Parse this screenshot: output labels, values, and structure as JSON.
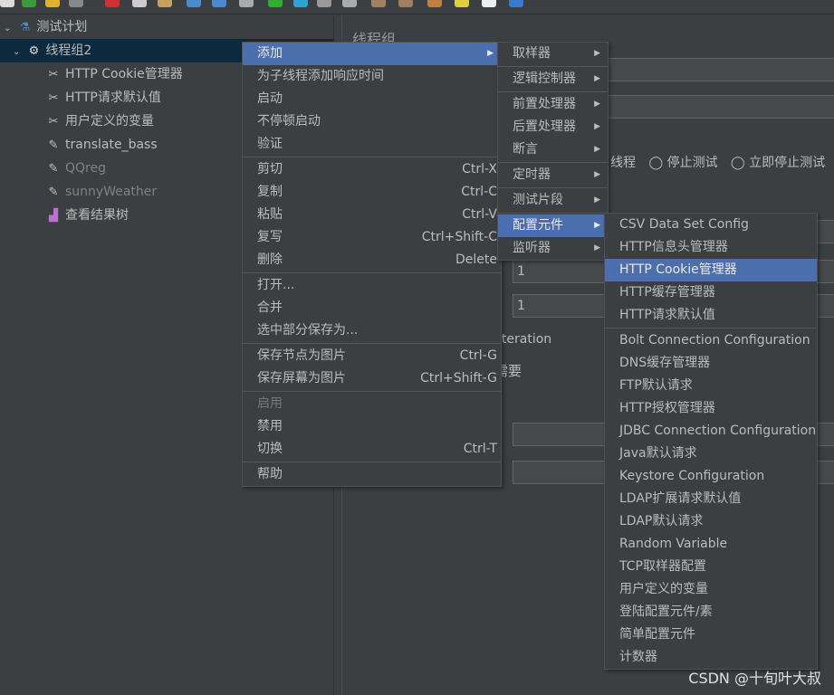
{
  "colors": {
    "background": "#3c3f41",
    "selection": "#0d293e",
    "menu_highlight": "#4b6eaf"
  },
  "tree": {
    "root": {
      "label": "测试计划",
      "icon": "flask-icon"
    },
    "thread_group": {
      "label": "线程组2",
      "icon": "gear-icon"
    },
    "children": [
      {
        "label": "HTTP Cookie管理器",
        "icon": "wrench-icon",
        "disabled": false
      },
      {
        "label": "HTTP请求默认值",
        "icon": "wrench-icon",
        "disabled": false
      },
      {
        "label": "用户定义的变量",
        "icon": "wrench-icon",
        "disabled": false
      },
      {
        "label": "translate_bass",
        "icon": "pipette-icon",
        "disabled": false
      },
      {
        "label": "QQreg",
        "icon": "pipette-icon",
        "disabled": true
      },
      {
        "label": "sunnyWeather",
        "icon": "pipette-icon",
        "disabled": true
      },
      {
        "label": "查看结果树",
        "icon": "chart-icon",
        "disabled": false
      }
    ]
  },
  "right": {
    "title": "线程组",
    "radio_partial": "线程",
    "radio_stop_test": "停止测试",
    "radio_stop_now": "立即停止测试",
    "field1": "1",
    "field2": "1",
    "iteration": "iteration",
    "need": "需要"
  },
  "context_menu": [
    {
      "label": "添加",
      "arrow": true,
      "hl": true
    },
    {
      "label": "为子线程添加响应时间"
    },
    {
      "label": "启动"
    },
    {
      "label": "不停顿启动"
    },
    {
      "label": "验证",
      "sep": true
    },
    {
      "label": "剪切",
      "sc": "Ctrl-X"
    },
    {
      "label": "复制",
      "sc": "Ctrl-C"
    },
    {
      "label": "粘贴",
      "sc": "Ctrl-V"
    },
    {
      "label": "复写",
      "sc": "Ctrl+Shift-C"
    },
    {
      "label": "删除",
      "sc": "Delete",
      "sep": true
    },
    {
      "label": "打开..."
    },
    {
      "label": "合并"
    },
    {
      "label": "选中部分保存为...",
      "sep": true
    },
    {
      "label": "保存节点为图片",
      "sc": "Ctrl-G"
    },
    {
      "label": "保存屏幕为图片",
      "sc": "Ctrl+Shift-G",
      "sep": true
    },
    {
      "label": "启用",
      "dis": true
    },
    {
      "label": "禁用"
    },
    {
      "label": "切换",
      "sc": "Ctrl-T",
      "sep": true
    },
    {
      "label": "帮助"
    }
  ],
  "add_menu": [
    {
      "label": "取样器",
      "arrow": true,
      "sep": true
    },
    {
      "label": "逻辑控制器",
      "arrow": true,
      "sep": true
    },
    {
      "label": "前置处理器",
      "arrow": true
    },
    {
      "label": "后置处理器",
      "arrow": true
    },
    {
      "label": "断言",
      "arrow": true,
      "sep": true
    },
    {
      "label": "定时器",
      "arrow": true,
      "sep": true
    },
    {
      "label": "测试片段",
      "arrow": true,
      "sep": true
    },
    {
      "label": "配置元件",
      "arrow": true,
      "hl": true
    },
    {
      "label": "监听器",
      "arrow": true
    }
  ],
  "config_menu": [
    {
      "label": "CSV Data Set Config"
    },
    {
      "label": "HTTP信息头管理器"
    },
    {
      "label": "HTTP Cookie管理器",
      "hl": true
    },
    {
      "label": "HTTP缓存管理器"
    },
    {
      "label": "HTTP请求默认值",
      "sep": true
    },
    {
      "label": "Bolt Connection Configuration"
    },
    {
      "label": "DNS缓存管理器"
    },
    {
      "label": "FTP默认请求"
    },
    {
      "label": "HTTP授权管理器"
    },
    {
      "label": "JDBC Connection Configuration"
    },
    {
      "label": "Java默认请求"
    },
    {
      "label": "Keystore Configuration"
    },
    {
      "label": "LDAP扩展请求默认值"
    },
    {
      "label": "LDAP默认请求"
    },
    {
      "label": "Random Variable"
    },
    {
      "label": "TCP取样器配置"
    },
    {
      "label": "用户定义的变量"
    },
    {
      "label": "登陆配置元件/素"
    },
    {
      "label": "简单配置元件"
    },
    {
      "label": "计数器"
    }
  ],
  "watermark": "CSDN @十旬叶大叔"
}
